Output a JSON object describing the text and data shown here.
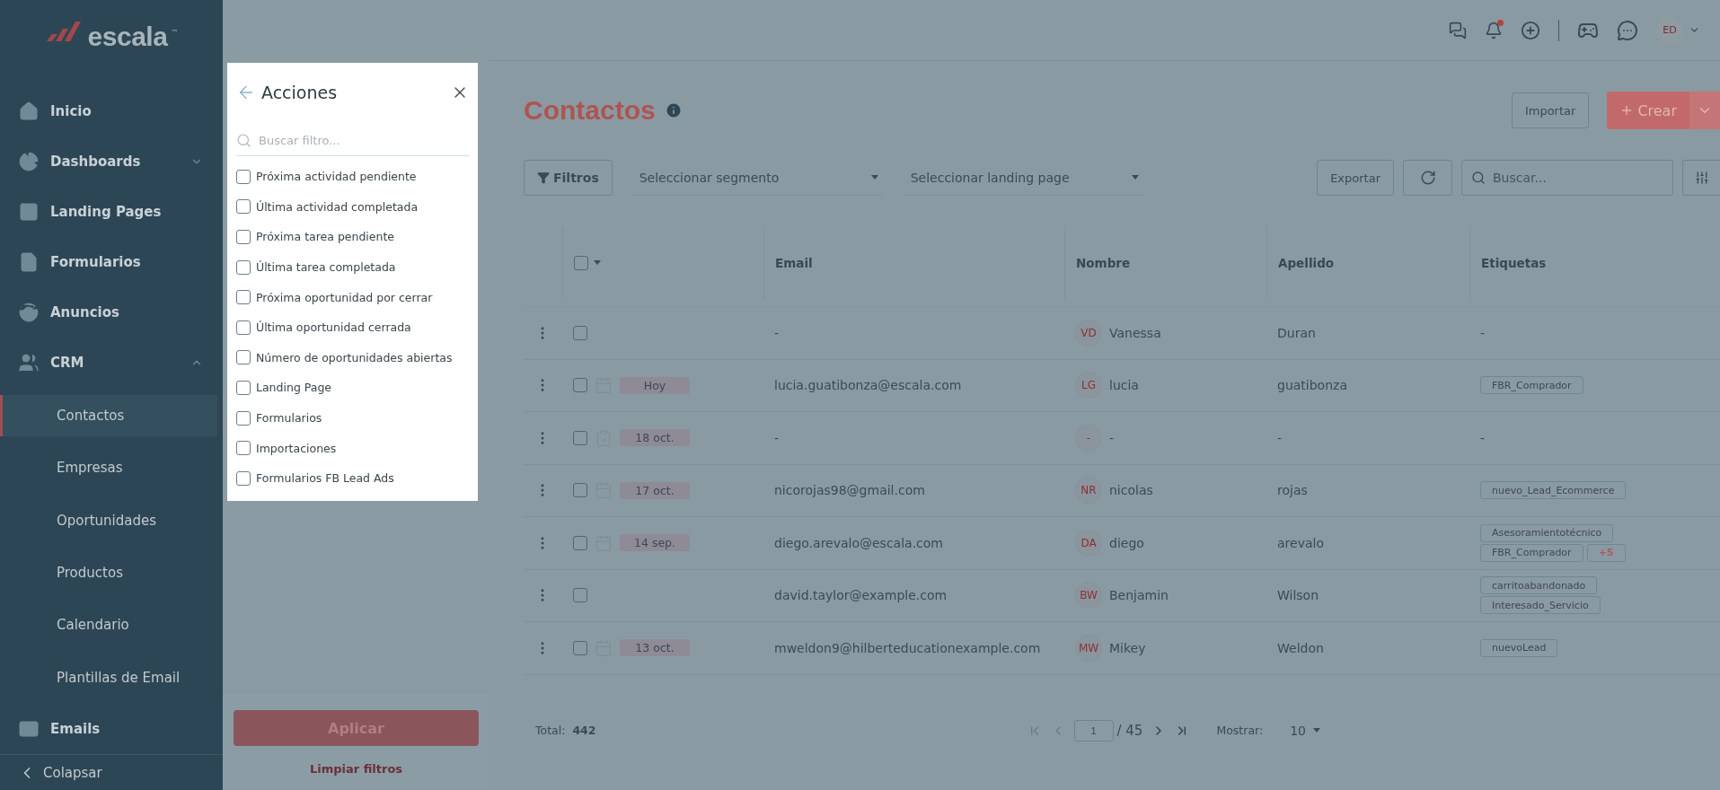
{
  "logo": {
    "text": "escala",
    "tm": "™"
  },
  "sidebar": {
    "items": [
      {
        "label": "Inicio"
      },
      {
        "label": "Dashboards",
        "expanded": false
      },
      {
        "label": "Landing Pages"
      },
      {
        "label": "Formularios"
      },
      {
        "label": "Anuncios"
      },
      {
        "label": "CRM",
        "expanded": true,
        "children": [
          {
            "label": "Contactos",
            "selected": true
          },
          {
            "label": "Empresas",
            "selected": false
          },
          {
            "label": "Oportunidades",
            "selected": false
          },
          {
            "label": "Productos",
            "selected": false
          },
          {
            "label": "Calendario",
            "selected": false
          },
          {
            "label": "Plantillas de Email",
            "selected": false
          }
        ]
      },
      {
        "label": "Emails"
      }
    ],
    "collapse": "Colapsar"
  },
  "header": {
    "unread": true,
    "avatar": "ED"
  },
  "filter_panel": {
    "title": "Acciones",
    "placeholder": "Buscar filtro...",
    "options": [
      {
        "label": "Próxima actividad pendiente",
        "checked": false
      },
      {
        "label": "Última actividad completada",
        "checked": false
      },
      {
        "label": "Próxima tarea pendiente",
        "checked": false
      },
      {
        "label": "Última tarea completada",
        "checked": false
      },
      {
        "label": "Próxima oportunidad por cerrar",
        "checked": false
      },
      {
        "label": "Última oportunidad cerrada",
        "checked": false
      },
      {
        "label": "Número de oportunidades abiertas",
        "checked": false
      },
      {
        "label": "Landing Page",
        "checked": false
      },
      {
        "label": "Formularios",
        "checked": false
      },
      {
        "label": "Importaciones",
        "checked": false
      },
      {
        "label": "Formularios FB Lead Ads",
        "checked": false
      }
    ],
    "apply": "Aplicar",
    "clear": "Limpiar filtros"
  },
  "page": {
    "title": "Contactos",
    "import": "Importar",
    "create": "Crear"
  },
  "toolbar": {
    "filters": "Filtros",
    "segment": "Seleccionar segmento",
    "landing": "Seleccionar landing page",
    "export": "Exportar",
    "placeholder": "Buscar..."
  },
  "table": {
    "all_checked": false,
    "columns": [
      "Email",
      "Nombre",
      "Apellido",
      "Etiquetas"
    ],
    "rows": [
      {
        "checked": false,
        "kind": "none",
        "email": "-",
        "initials": "VD",
        "first": "Vanessa",
        "last": "Duran",
        "no_tags": "-"
      },
      {
        "checked": false,
        "kind": "event",
        "date": "Hoy",
        "email": "lucia.guatibonza@escala.com",
        "initials": "LG",
        "first": "lucia",
        "last": "guatibonza",
        "tags": [
          "FBR_Comprador"
        ]
      },
      {
        "checked": false,
        "kind": "task",
        "date": "18 oct.",
        "email": "-",
        "initials": "-",
        "first": "-",
        "last": "-",
        "no_tags": "-"
      },
      {
        "checked": false,
        "kind": "event",
        "date": "17 oct.",
        "email": "nicorojas98@gmail.com",
        "initials": "NR",
        "first": "nicolas",
        "last": "rojas",
        "tags": [
          "nuevo_Lead_Ecommerce"
        ]
      },
      {
        "checked": false,
        "kind": "event",
        "date": "14 sep.",
        "email": "diego.arevalo@escala.com",
        "initials": "DA",
        "first": "diego",
        "last": "arevalo",
        "tags": [
          "Asesoramientotécnico",
          "FBR_Comprador"
        ],
        "more": "+5"
      },
      {
        "checked": false,
        "kind": "none",
        "email": "david.taylor@example.com",
        "initials": "BW",
        "first": "Benjamin",
        "last": "Wilson",
        "tags": [
          "carritoabandonado",
          "Interesado_Servicio"
        ]
      },
      {
        "checked": false,
        "kind": "event",
        "date": "13 oct.",
        "email": "mweldon9@hilberteducationexample.com",
        "initials": "MW",
        "first": "Mikey",
        "last": "Weldon",
        "tags": [
          "nuevoLead"
        ]
      }
    ]
  },
  "footer": {
    "total_label": "Total:",
    "total": "442",
    "page": "1",
    "pages": "/ 45",
    "show_label": "Mostrar:",
    "show": "10"
  }
}
